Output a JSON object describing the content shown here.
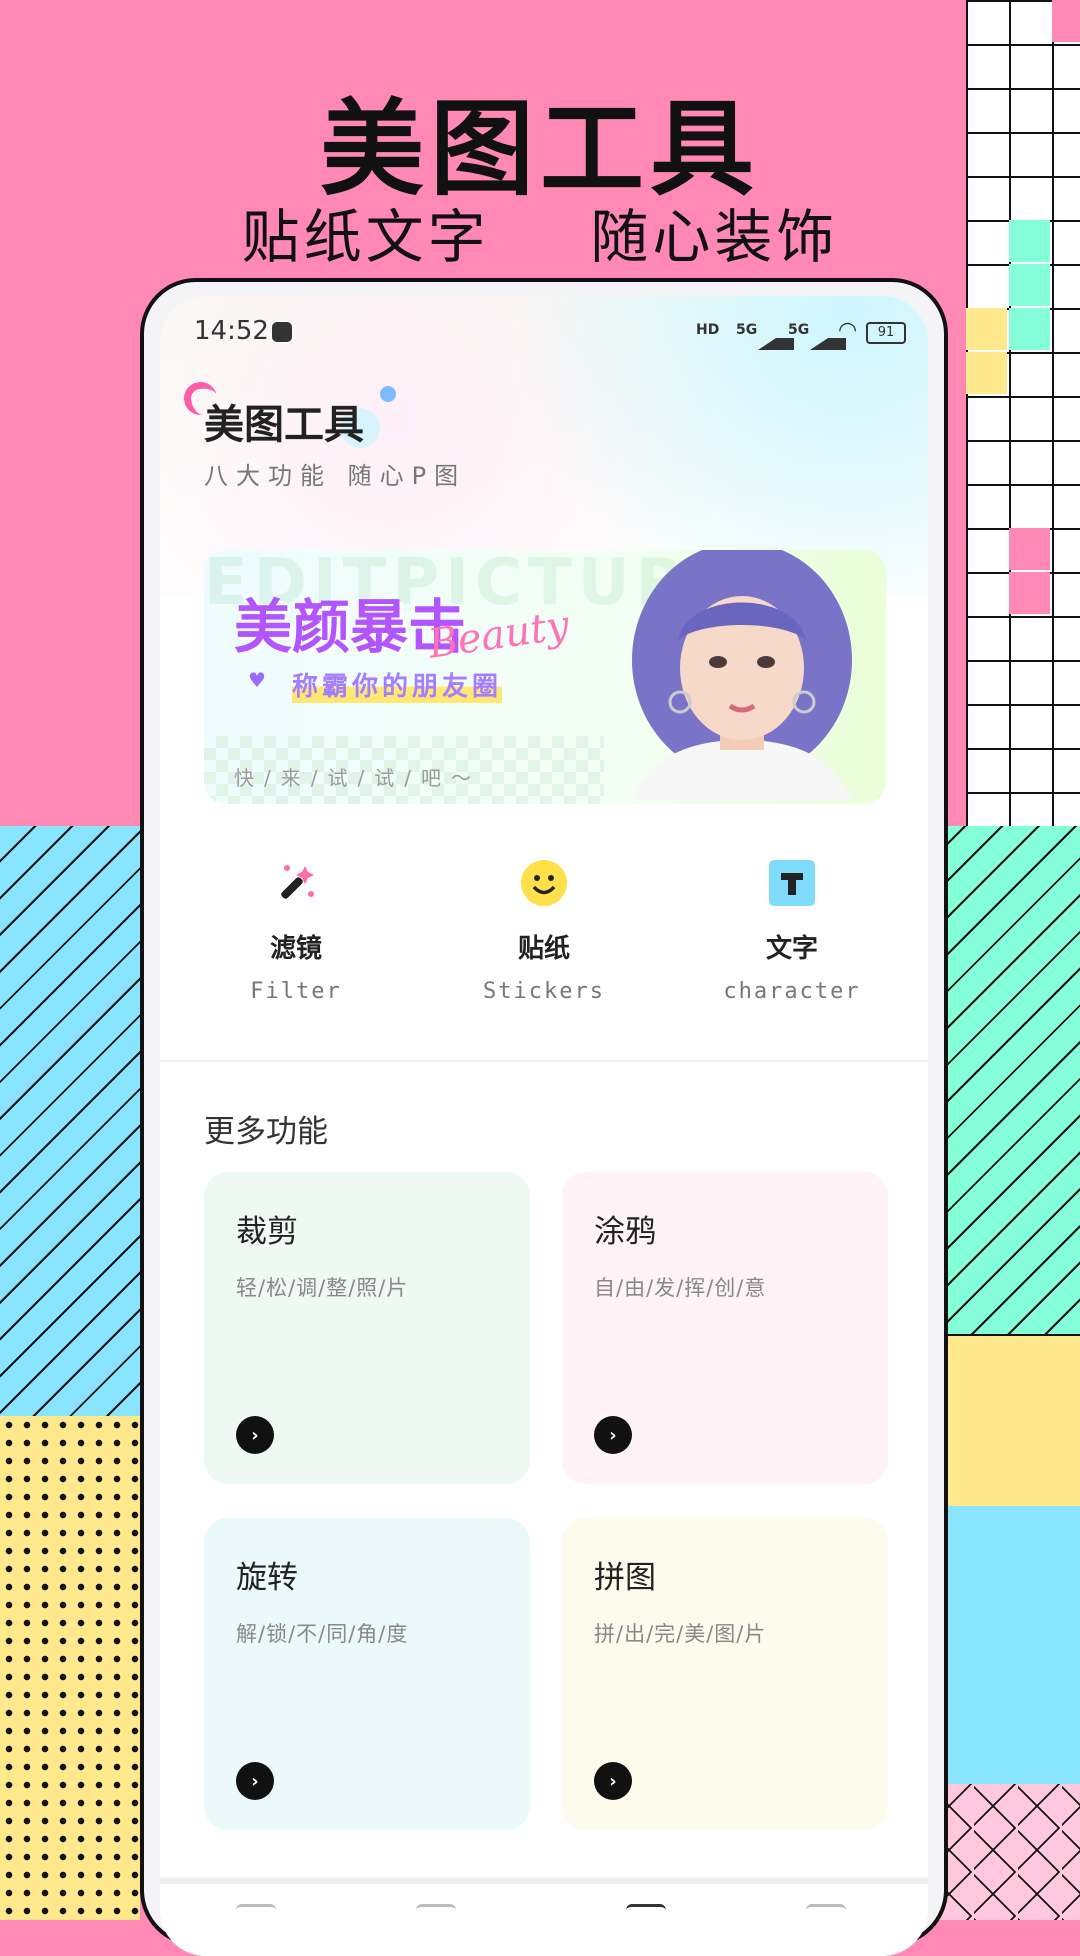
{
  "hero": {
    "title": "美图工具",
    "subtitle": "贴纸文字  随心装饰"
  },
  "status_bar": {
    "time": "14:52",
    "battery": "91",
    "hd": "HD",
    "net1": "5G",
    "net2": "5G"
  },
  "app": {
    "title": "美图工具",
    "subtitle": "八大功能 随心P图"
  },
  "banner": {
    "bg_text": "EDITPICTURE",
    "title": "美颜暴击",
    "script": "Beauty",
    "tagline": "称霸你的朋友圈",
    "footer": "快/来/试/试/吧～"
  },
  "quick_actions": [
    {
      "label": "滤镜",
      "en": "Filter",
      "icon": "magic-wand-icon"
    },
    {
      "label": "贴纸",
      "en": "Stickers",
      "icon": "smiley-icon"
    },
    {
      "label": "文字",
      "en": "character",
      "icon": "text-t-icon"
    }
  ],
  "more": {
    "title": "更多功能",
    "cards": [
      {
        "title": "裁剪",
        "sub": "轻/松/调/整/照/片",
        "color": "#eff9f3"
      },
      {
        "title": "涂鸦",
        "sub": "自/由/发/挥/创/意",
        "color": "#fff3f8"
      },
      {
        "title": "旋转",
        "sub": "解/锁/不/同/角/度",
        "color": "#ecf9fc"
      },
      {
        "title": "拼图",
        "sub": "拼/出/完/美/图/片",
        "color": "#fdfbec"
      }
    ]
  },
  "colors": {
    "accent_pink": "#ff88b4",
    "accent_purple": "#b255ff"
  }
}
